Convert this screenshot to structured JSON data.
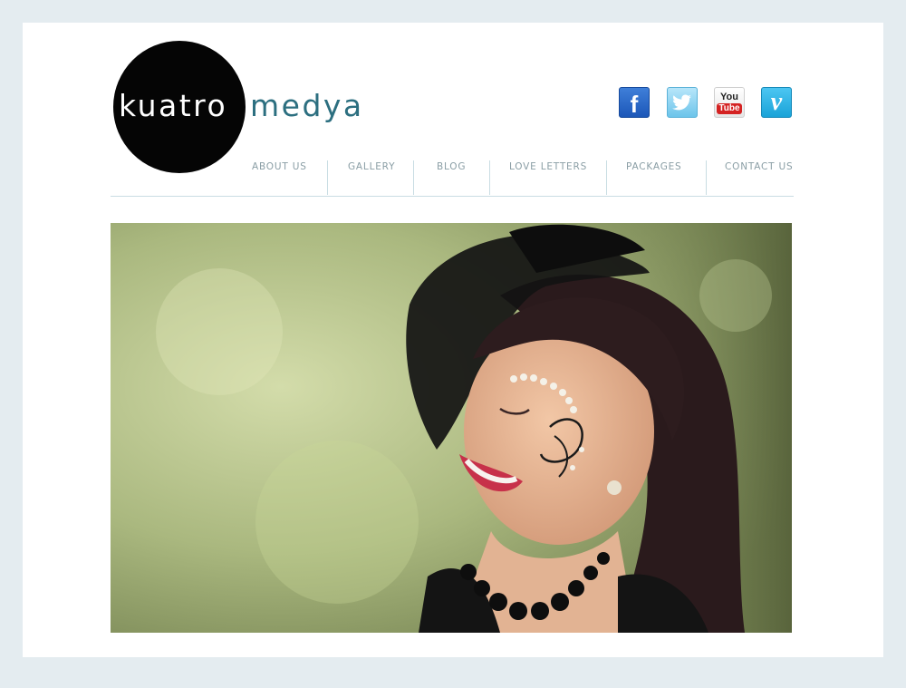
{
  "logo": {
    "word_1": "kuatro",
    "word_2": "medya"
  },
  "social": [
    {
      "name": "facebook",
      "glyph": "f"
    },
    {
      "name": "twitter",
      "glyph": "bird"
    },
    {
      "name": "youtube",
      "you": "You",
      "tube": "Tube"
    },
    {
      "name": "vimeo",
      "glyph": "v"
    }
  ],
  "nav": {
    "items": [
      {
        "label": "ABOUT US"
      },
      {
        "label": "GALLERY"
      },
      {
        "label": "BLOG"
      },
      {
        "label": "LOVE LETTERS"
      },
      {
        "label": "PACKAGES"
      },
      {
        "label": "CONTACT US"
      }
    ]
  },
  "colors": {
    "page_background": "#e4ecf0",
    "card_background": "#ffffff",
    "logo_circle": "#050505",
    "logo_accent": "#2c6f80",
    "nav_text": "#8a9ea5",
    "nav_divider": "#c9dde3"
  }
}
